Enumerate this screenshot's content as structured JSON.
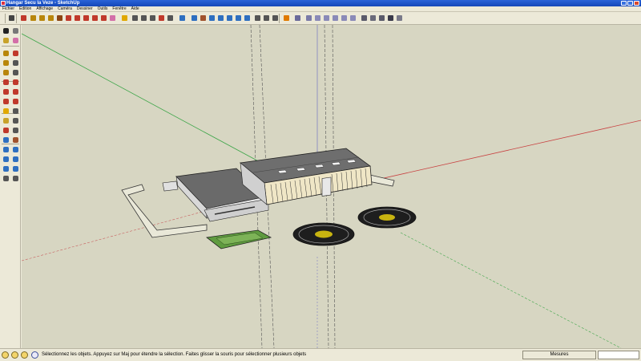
{
  "window": {
    "title": "Hangar Secu la Veze - SketchUp"
  },
  "menu": {
    "items": [
      "Fichier",
      "Edition",
      "Affichage",
      "Caméra",
      "Dessiner",
      "Outils",
      "Fenêtre",
      "Aide"
    ]
  },
  "toolbar": {
    "tools": [
      {
        "icon": "select-arrow-icon",
        "color": "#444444"
      },
      {
        "icon": "pencil-icon",
        "color": "#c0392b"
      },
      {
        "icon": "rectangle-icon",
        "color": "#b8860b"
      },
      {
        "icon": "circle-icon",
        "color": "#b8860b"
      },
      {
        "icon": "arc-icon",
        "color": "#b8860b"
      },
      {
        "icon": "push-pull-icon",
        "color": "#8b4513"
      },
      {
        "icon": "move-icon",
        "color": "#c0392b"
      },
      {
        "icon": "rotate-icon",
        "color": "#c0392b"
      },
      {
        "icon": "follow-me-icon",
        "color": "#c0392b"
      },
      {
        "icon": "scale-icon",
        "color": "#c0392b"
      },
      {
        "icon": "offset-icon",
        "color": "#c0392b"
      },
      {
        "icon": "eraser-icon",
        "color": "#d36fa8"
      },
      {
        "icon": "tape-measure-icon",
        "color": "#e0a800"
      },
      {
        "icon": "dimension-icon",
        "color": "#555555"
      },
      {
        "icon": "protractor-icon",
        "color": "#555555"
      },
      {
        "icon": "text-icon",
        "color": "#555555"
      },
      {
        "icon": "axes-icon",
        "color": "#c0392b"
      },
      {
        "icon": "3d-text-icon",
        "color": "#555555"
      },
      {
        "icon": "paint-bucket-icon",
        "color": "#2e6fc0"
      },
      {
        "icon": "orbit-icon",
        "color": "#2e6fc0"
      },
      {
        "icon": "pan-icon",
        "color": "#a0522d"
      },
      {
        "icon": "zoom-icon",
        "color": "#2e6fc0"
      },
      {
        "icon": "zoom-window-icon",
        "color": "#2e6fc0"
      },
      {
        "icon": "zoom-extents-icon",
        "color": "#2e6fc0"
      },
      {
        "icon": "previous-view-icon",
        "color": "#2e6fc0"
      },
      {
        "icon": "next-view-icon",
        "color": "#2e6fc0"
      },
      {
        "icon": "position-camera-icon",
        "color": "#555555"
      },
      {
        "icon": "walk-icon",
        "color": "#555555"
      },
      {
        "icon": "look-around-icon",
        "color": "#555555"
      },
      {
        "icon": "section-plane-icon",
        "color": "#e07a00"
      },
      {
        "icon": "xray-icon",
        "color": "#6a6a9a"
      },
      {
        "icon": "iso-view-icon",
        "color": "#7a7aa8"
      },
      {
        "icon": "top-view-icon",
        "color": "#8a8ab8"
      },
      {
        "icon": "front-view-icon",
        "color": "#8a8ab8"
      },
      {
        "icon": "right-view-icon",
        "color": "#8a8ab8"
      },
      {
        "icon": "back-view-icon",
        "color": "#8a8ab8"
      },
      {
        "icon": "left-view-icon",
        "color": "#8a8ab8"
      },
      {
        "icon": "wireframe-icon",
        "color": "#5a5a6a"
      },
      {
        "icon": "hidden-line-icon",
        "color": "#6a6a7a"
      },
      {
        "icon": "shaded-icon",
        "color": "#5a5a6a"
      },
      {
        "icon": "shaded-textures-icon",
        "color": "#3a3a4a"
      },
      {
        "icon": "monochrome-icon",
        "color": "#7a7a8a"
      }
    ]
  },
  "palette": {
    "tools": [
      {
        "icon": "select-arrow-icon",
        "color": "#222222"
      },
      {
        "icon": "make-component-icon",
        "color": "#777777"
      },
      {
        "icon": "paint-bucket-icon",
        "color": "#c8a22a"
      },
      {
        "icon": "eraser-icon",
        "color": "#d36fa8"
      },
      {
        "icon": "rectangle-icon",
        "color": "#b8860b"
      },
      {
        "icon": "line-icon",
        "color": "#c0392b"
      },
      {
        "icon": "circle-icon",
        "color": "#b8860b"
      },
      {
        "icon": "arc-icon",
        "color": "#555555"
      },
      {
        "icon": "polygon-icon",
        "color": "#b8860b"
      },
      {
        "icon": "freehand-icon",
        "color": "#555555"
      },
      {
        "icon": "move-icon",
        "color": "#c0392b"
      },
      {
        "icon": "push-pull-icon",
        "color": "#c0392b"
      },
      {
        "icon": "rotate-icon",
        "color": "#c0392b"
      },
      {
        "icon": "follow-me-icon",
        "color": "#c0392b"
      },
      {
        "icon": "scale-icon",
        "color": "#c0392b"
      },
      {
        "icon": "offset-icon",
        "color": "#c0392b"
      },
      {
        "icon": "tape-measure-icon",
        "color": "#e0a800"
      },
      {
        "icon": "dimension-icon",
        "color": "#555555"
      },
      {
        "icon": "protractor-icon",
        "color": "#c8a22a"
      },
      {
        "icon": "text-icon",
        "color": "#555555"
      },
      {
        "icon": "axes-icon",
        "color": "#c0392b"
      },
      {
        "icon": "3d-text-icon",
        "color": "#555555"
      },
      {
        "icon": "orbit-icon",
        "color": "#2e6fc0"
      },
      {
        "icon": "pan-icon",
        "color": "#a0522d"
      },
      {
        "icon": "zoom-icon",
        "color": "#2e6fc0"
      },
      {
        "icon": "zoom-window-icon",
        "color": "#2e6fc0"
      },
      {
        "icon": "zoom-extents-icon",
        "color": "#2e6fc0"
      },
      {
        "icon": "previous-view-icon",
        "color": "#2e6fc0"
      },
      {
        "icon": "position-camera-icon",
        "color": "#2e6fc0"
      },
      {
        "icon": "walk-icon",
        "color": "#2e6fc0"
      },
      {
        "icon": "look-around-icon",
        "color": "#555555"
      },
      {
        "icon": "section-plane-icon",
        "color": "#555555"
      }
    ]
  },
  "viewport": {
    "background": "#d7d6c2",
    "axis_colors": {
      "red": "#c86060",
      "green": "#3fa64a",
      "blue": "#8080c0"
    }
  },
  "statusbar": {
    "icons": [
      "geolocation-icon",
      "credits-icon",
      "help-icon"
    ],
    "message": "Sélectionnez les objets. Appuyez sur Maj pour étendre la sélection. Faites glisser la souris pour sélectionner plusieurs objets",
    "measures_label": "Mesures",
    "measures_value": ""
  }
}
